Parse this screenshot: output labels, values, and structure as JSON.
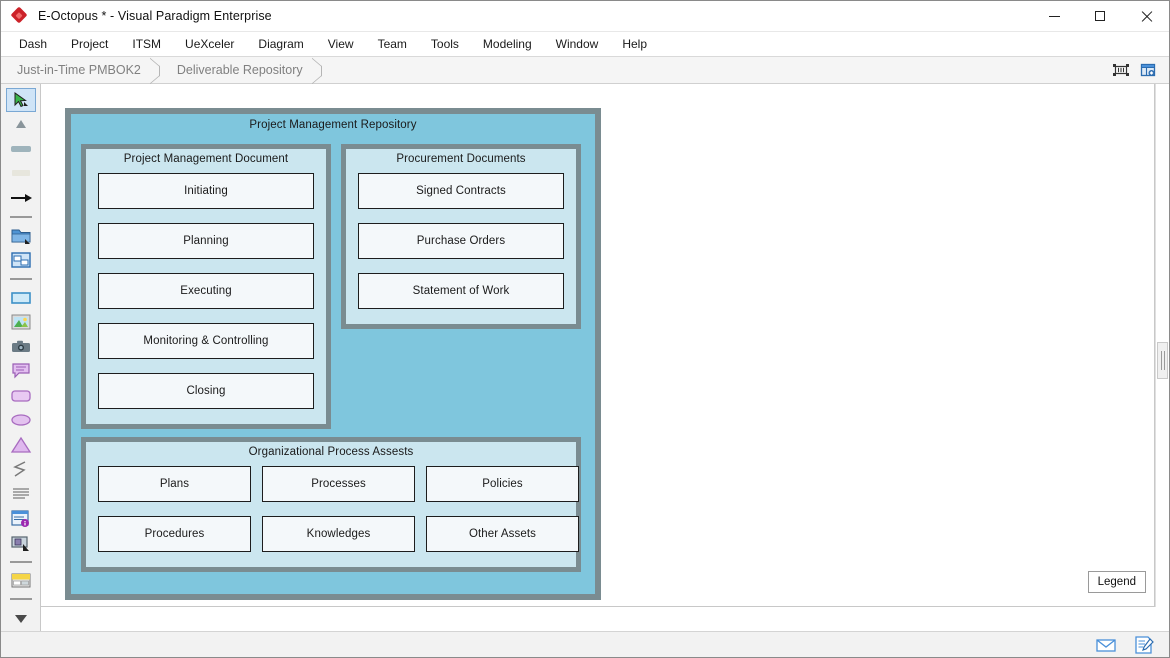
{
  "window": {
    "title": "E-Octopus * - Visual Paradigm Enterprise",
    "logo_icon": "red-diamond-logo-icon",
    "controls": {
      "minimize": "minimize-icon",
      "maximize": "maximize-icon",
      "close": "close-icon"
    }
  },
  "menubar": {
    "items": [
      {
        "label": "Dash"
      },
      {
        "label": "Project"
      },
      {
        "label": "ITSM"
      },
      {
        "label": "UeXceler"
      },
      {
        "label": "Diagram"
      },
      {
        "label": "View"
      },
      {
        "label": "Team"
      },
      {
        "label": "Tools"
      },
      {
        "label": "Modeling"
      },
      {
        "label": "Window"
      },
      {
        "label": "Help"
      }
    ]
  },
  "breadcrumb": {
    "items": [
      {
        "label": "Just-in-Time PMBOK2"
      },
      {
        "label": "Deliverable Repository"
      }
    ],
    "tools": [
      {
        "icon": "fit-to-screen-icon"
      },
      {
        "icon": "diagram-properties-icon"
      }
    ]
  },
  "palette": {
    "tools": [
      {
        "icon": "pointer-select-icon",
        "selected": true
      },
      {
        "icon": "triangle-generalization-icon",
        "selected": false
      },
      {
        "icon": "rounded-bar-icon",
        "selected": false
      },
      {
        "icon": "pale-bar-icon",
        "selected": false
      },
      {
        "icon": "arrow-connector-icon",
        "selected": false
      },
      {
        "icon": "separator",
        "selected": false
      },
      {
        "icon": "folder-icon",
        "selected": false
      },
      {
        "icon": "diagram-window-icon",
        "selected": false
      },
      {
        "icon": "separator",
        "selected": false
      },
      {
        "icon": "rectangle-shape-icon",
        "selected": false
      },
      {
        "icon": "image-picture-icon",
        "selected": false
      },
      {
        "icon": "camera-snapshot-icon",
        "selected": false
      },
      {
        "icon": "comment-balloon-icon",
        "selected": false
      },
      {
        "icon": "rounded-rectangle-icon",
        "selected": false
      },
      {
        "icon": "ellipse-icon",
        "selected": false
      },
      {
        "icon": "triangle-shape-icon",
        "selected": false
      },
      {
        "icon": "zigzag-line-icon",
        "selected": false
      },
      {
        "icon": "text-lines-icon",
        "selected": false
      },
      {
        "icon": "document-info-icon",
        "selected": false
      },
      {
        "icon": "stamp-icon",
        "selected": false
      },
      {
        "icon": "separator",
        "selected": false
      },
      {
        "icon": "table-grid-icon",
        "selected": false
      },
      {
        "icon": "separator",
        "selected": false
      },
      {
        "icon": "more-tools-dropdown-icon",
        "selected": false
      }
    ]
  },
  "canvas": {
    "legend_button": "Legend",
    "scrollbar": "vertical-scrollbar"
  },
  "diagram": {
    "root": {
      "title": "Project Management Repository",
      "fill": "#7fc6dd",
      "border": "#7a8c91"
    },
    "groups": [
      {
        "id": "project-management-document",
        "title": "Project Management Document",
        "fill": "#cbe6ef",
        "columns": 1,
        "items": [
          {
            "label": "Initiating"
          },
          {
            "label": "Planning"
          },
          {
            "label": "Executing"
          },
          {
            "label": "Monitoring & Controlling"
          },
          {
            "label": "Closing"
          }
        ]
      },
      {
        "id": "procurement-documents",
        "title": "Procurement Documents",
        "fill": "#cbe6ef",
        "columns": 1,
        "items": [
          {
            "label": "Signed Contracts"
          },
          {
            "label": "Purchase Orders"
          },
          {
            "label": "Statement of Work"
          }
        ]
      },
      {
        "id": "organizational-process-assests",
        "title": "Organizational Process Assests",
        "fill": "#cbe6ef",
        "columns": 3,
        "items": [
          {
            "label": "Plans"
          },
          {
            "label": "Processes"
          },
          {
            "label": "Policies"
          },
          {
            "label": "Procedures"
          },
          {
            "label": "Knowledges"
          },
          {
            "label": "Other Assets"
          }
        ]
      }
    ]
  },
  "statusbar": {
    "icons": [
      {
        "icon": "mail-envelope-icon"
      },
      {
        "icon": "note-edit-icon"
      }
    ]
  }
}
